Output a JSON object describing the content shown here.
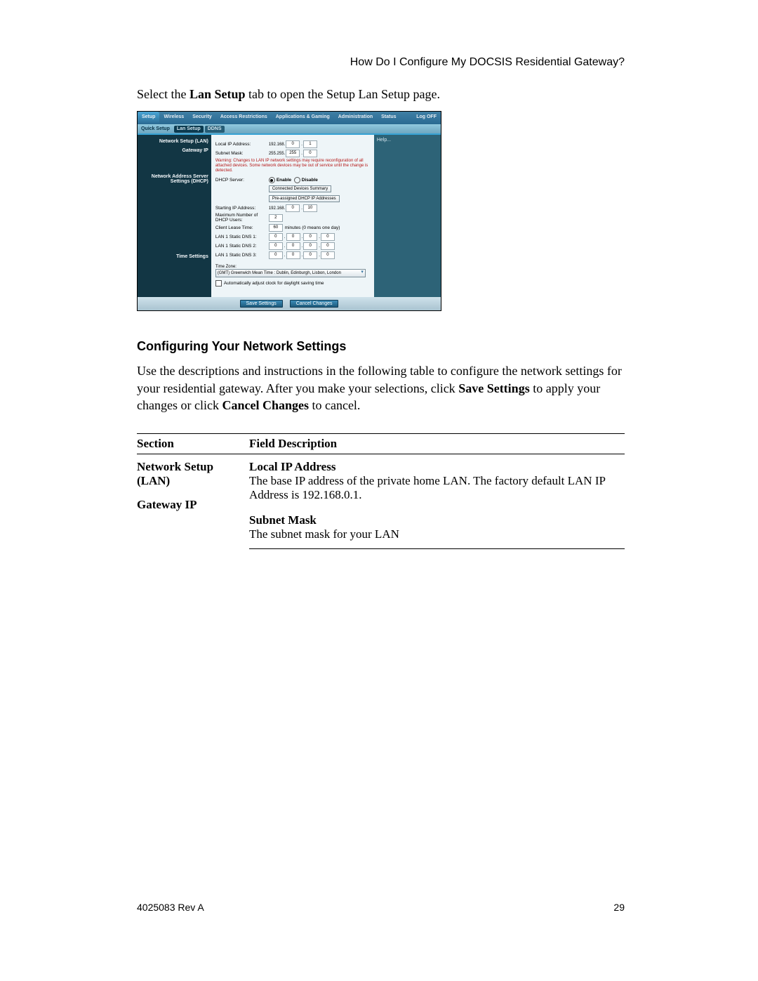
{
  "header": "How Do I Configure My DOCSIS Residential Gateway?",
  "intro_pre": "Select the ",
  "intro_bold": "Lan Setup",
  "intro_post": " tab to open the Setup Lan Setup page.",
  "tabs": {
    "setup": "Setup",
    "wireless": "Wireless",
    "security": "Security",
    "access": "Access Restrictions",
    "apps": "Applications & Gaming",
    "admin": "Administration",
    "status": "Status",
    "logoff": "Log OFF"
  },
  "subtabs": {
    "qs": "Quick Setup",
    "lan": "Lan Setup",
    "ddns": "DDNS"
  },
  "labels": {
    "network_setup": "Network Setup (LAN)",
    "gateway_ip": "Gateway IP",
    "dhcp_section": "Network Address Server Settings (DHCP)",
    "time_settings": "Time Settings",
    "help": "Help..."
  },
  "fields": {
    "local_ip": "Local IP Address:",
    "subnet": "Subnet Mask:",
    "warn": "Warning: Changes to LAN IP network settings may require reconfiguration of all attached devices. Some network devices may be out of service until the change is detected.",
    "dhcp_server": "DHCP Server:",
    "enable": "Enable",
    "disable": "Disable",
    "btn_cds": "Connected Devices Summary",
    "btn_pda": "Pre-assigned DHCP IP Addresses",
    "start_ip": "Starting IP Address:",
    "max_users": "Maximum Number of DHCP Users:",
    "lease": "Client Lease Time:",
    "lease_hint": "minutes (0 means one day)",
    "dns1": "LAN 1 Static DNS 1:",
    "dns2": "LAN 1 Static DNS 2:",
    "dns3": "LAN 1 Static DNS 3:",
    "tz_label": "Time Zone:",
    "tz_value": "(GMT) Greenwich Mean Time : Dublin, Edinburgh, Lisbon, London",
    "dst": "Automatically adjust clock for daylight saving time",
    "save": "Save Settings",
    "cancel": "Cancel Changes"
  },
  "ip": {
    "local_prefix": "192.168.",
    "local_o3": "0",
    "local_o4": "1",
    "subnet_prefix": "255.255.",
    "subnet_o3": "255",
    "subnet_o4": "0",
    "start_prefix": "192.168.",
    "start_o3": "0",
    "start_o4": "10",
    "max_users": "2",
    "lease": "60",
    "zeros": [
      "0",
      "0",
      "0",
      "0"
    ]
  },
  "section2_title": "Configuring Your Network Settings",
  "section2_para_pre": "Use the descriptions and instructions in the following table to configure the network settings for your residential gateway. After you make your selections, click ",
  "section2_bold1": "Save Settings",
  "section2_mid": " to apply your changes or click ",
  "section2_bold2": "Cancel Changes",
  "section2_end": " to cancel.",
  "table": {
    "h1": "Section",
    "h2": "Field Description",
    "r1c1a": "Network Setup (LAN)",
    "r1c1b": "Gateway IP",
    "f1_title": "Local IP Address",
    "f1_desc": "The base IP address of the private home LAN. The factory default LAN IP Address is 192.168.0.1.",
    "f2_title": "Subnet Mask",
    "f2_desc": "The subnet mask for your LAN"
  },
  "footer": {
    "left": "4025083 Rev A",
    "right": "29"
  }
}
